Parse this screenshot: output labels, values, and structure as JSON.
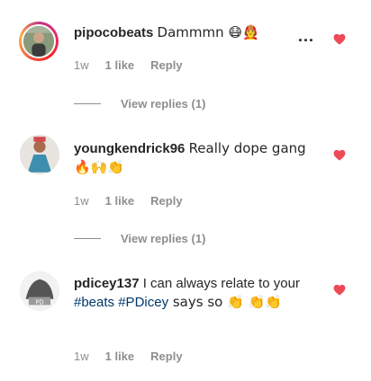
{
  "comments": [
    {
      "username": "pipocobeats",
      "text": "Dammmn 😷🧑‍🚒",
      "time": "1w",
      "likes": "1 like",
      "reply": "Reply",
      "more": "..."
    },
    {
      "username": "youngkendrick96",
      "text": "Really dope gang 🔥🙌👏",
      "time": "1w",
      "likes": "1 like",
      "reply": "Reply"
    },
    {
      "username": "pdicey137",
      "text_before": "I can always relate to your ",
      "hashtag1": "#beats",
      "hashtag2": "#PDicey",
      "text_after": " says so 👏 👏👏",
      "time": "1w",
      "likes": "1 like",
      "reply": "Reply"
    }
  ],
  "view_replies": [
    "View replies (1)",
    "View replies (1)"
  ],
  "colors": {
    "heart": "#ed4956",
    "muted": "#8e8e8e",
    "hashtag": "#00376b"
  },
  "icons": [
    "heart-icon",
    "more-options-icon"
  ]
}
